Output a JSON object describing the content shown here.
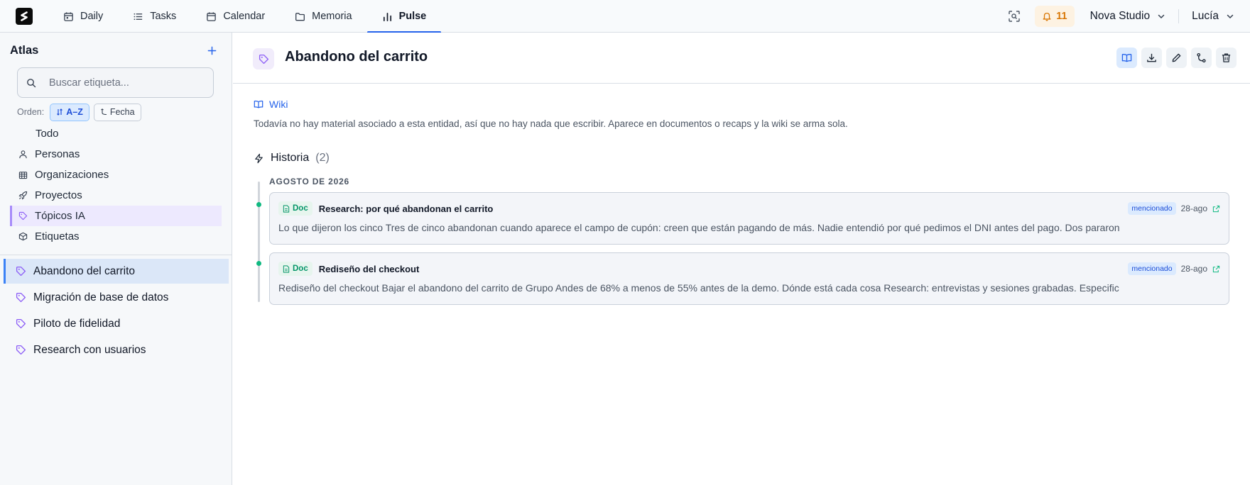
{
  "app": {
    "nav": [
      {
        "label": "Daily",
        "icon": "calendar-day-icon"
      },
      {
        "label": "Tasks",
        "icon": "list-icon"
      },
      {
        "label": "Calendar",
        "icon": "calendar-icon"
      },
      {
        "label": "Memoria",
        "icon": "folder-icon"
      },
      {
        "label": "Pulse",
        "icon": "bar-chart-icon",
        "active": true
      }
    ],
    "notifications": "11",
    "workspace": "Nova Studio",
    "user": "Lucía"
  },
  "sidebar": {
    "title": "Atlas",
    "search_placeholder": "Buscar etiqueta...",
    "order_label": "Orden:",
    "order_az": "A–Z",
    "order_date": "Fecha",
    "categories": [
      {
        "label": "Todo"
      },
      {
        "label": "Personas",
        "icon": "person-icon"
      },
      {
        "label": "Organizaciones",
        "icon": "building-icon"
      },
      {
        "label": "Proyectos",
        "icon": "rocket-icon"
      },
      {
        "label": "Tópicos IA",
        "icon": "tag-icon",
        "active": true
      },
      {
        "label": "Etiquetas",
        "icon": "cube-icon"
      }
    ],
    "tags": [
      {
        "label": "Abandono del carrito",
        "active": true
      },
      {
        "label": "Migración de base de datos"
      },
      {
        "label": "Piloto de fidelidad"
      },
      {
        "label": "Research con usuarios"
      }
    ]
  },
  "main": {
    "title": "Abandono del carrito",
    "wiki_label": "Wiki",
    "wiki_text": "Todavía no hay material asociado a esta entidad, así que no hay nada que escribir. Aparece en documentos o recaps y la wiki se arma sola.",
    "history_label": "Historia",
    "history_count": "(2)",
    "month": "AGOSTO DE 2026",
    "entries": [
      {
        "type": "Doc",
        "title": "Research: por qué abandonan el carrito",
        "badge": "mencionado",
        "date": "28-ago",
        "snippet": "Lo que dijeron los cinco Tres de cinco abandonan cuando aparece el campo de cupón: creen que están pagando de más. Nadie entendió por qué pedimos el DNI antes del pago. Dos pararon"
      },
      {
        "type": "Doc",
        "title": "Rediseño del checkout",
        "badge": "mencionado",
        "date": "28-ago",
        "snippet": "Rediseño del checkout Bajar el abandono del carrito de Grupo Andes de 68% a menos de 55% antes de la demo. Dónde está cada cosa Research: entrevistas y sesiones grabadas. Especific"
      }
    ]
  },
  "colors": {
    "accent": "#2563eb",
    "tag_purple": "#8b5cf6",
    "success": "#10b981",
    "warning": "#d97706"
  }
}
